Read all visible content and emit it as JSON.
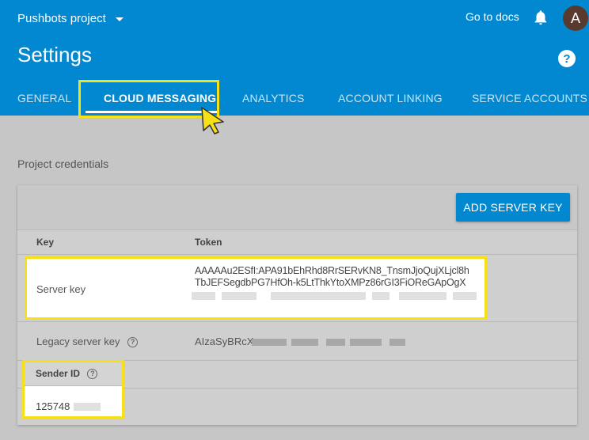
{
  "header": {
    "project_name": "Pushbots project",
    "docs_link": "Go to docs",
    "avatar_letter": "A",
    "page_title": "Settings",
    "help": "?"
  },
  "tabs": [
    {
      "label": "GENERAL",
      "active": false
    },
    {
      "label": "CLOUD MESSAGING",
      "active": true
    },
    {
      "label": "ANALYTICS",
      "active": false
    },
    {
      "label": "ACCOUNT LINKING",
      "active": false
    },
    {
      "label": "SERVICE ACCOUNTS",
      "active": false
    }
  ],
  "credentials": {
    "section_title": "Project credentials",
    "add_button": "ADD SERVER KEY",
    "columns": {
      "key": "Key",
      "token": "Token"
    },
    "server_key": {
      "label": "Server key",
      "token_line1": "AAAAAu2ESfI:APA91bEhRhd8RrSERvKN8_TnsmJjoQujXLjcl8h",
      "token_line2": "TbJEFSegdbPG7HfOh-k5LtThkYtoXMPz86rGI3FiOReGApOgX"
    },
    "legacy_key": {
      "label": "Legacy server key",
      "token_prefix": "AIzaSyBRcX",
      "help": "?"
    },
    "sender_id": {
      "label": "Sender ID",
      "value": "125748",
      "help": "?"
    }
  },
  "colors": {
    "brand": "#0288d1",
    "highlight": "#f7e018"
  }
}
